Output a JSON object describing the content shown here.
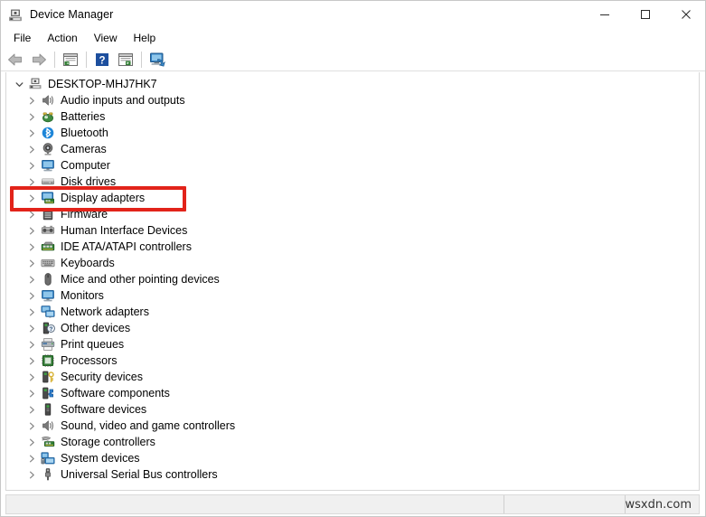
{
  "window": {
    "title": "Device Manager",
    "icon": "device-manager-icon",
    "controls": {
      "minimize": "minimize-icon",
      "maximize": "maximize-icon",
      "close": "close-icon"
    }
  },
  "menubar": {
    "items": [
      {
        "label": "File"
      },
      {
        "label": "Action"
      },
      {
        "label": "View"
      },
      {
        "label": "Help"
      }
    ]
  },
  "toolbar": {
    "buttons": [
      {
        "name": "back-arrow-icon",
        "tooltip": "Back"
      },
      {
        "name": "forward-arrow-icon",
        "tooltip": "Forward"
      },
      {
        "name": "show-hide-console-tree-icon",
        "tooltip": "Show/Hide Console Tree"
      },
      {
        "name": "help-icon",
        "tooltip": "Help"
      },
      {
        "name": "properties-icon",
        "tooltip": "Properties"
      },
      {
        "name": "scan-for-hardware-changes-icon",
        "tooltip": "Scan for hardware changes"
      }
    ]
  },
  "tree": {
    "root": {
      "label": "DESKTOP-MHJ7HK7",
      "icon": "computer-root-icon",
      "expanded": true
    },
    "items": [
      {
        "label": "Audio inputs and outputs",
        "icon": "speaker-icon"
      },
      {
        "label": "Batteries",
        "icon": "battery-icon"
      },
      {
        "label": "Bluetooth",
        "icon": "bluetooth-icon"
      },
      {
        "label": "Cameras",
        "icon": "camera-icon"
      },
      {
        "label": "Computer",
        "icon": "monitor-icon"
      },
      {
        "label": "Disk drives",
        "icon": "disk-drive-icon"
      },
      {
        "label": "Display adapters",
        "icon": "display-adapter-icon",
        "highlighted": true
      },
      {
        "label": "Firmware",
        "icon": "firmware-icon"
      },
      {
        "label": "Human Interface Devices",
        "icon": "hid-icon"
      },
      {
        "label": "IDE ATA/ATAPI controllers",
        "icon": "ide-controller-icon"
      },
      {
        "label": "Keyboards",
        "icon": "keyboard-icon"
      },
      {
        "label": "Mice and other pointing devices",
        "icon": "mouse-icon"
      },
      {
        "label": "Monitors",
        "icon": "monitor-icon"
      },
      {
        "label": "Network adapters",
        "icon": "network-adapter-icon"
      },
      {
        "label": "Other devices",
        "icon": "other-device-icon"
      },
      {
        "label": "Print queues",
        "icon": "printer-icon"
      },
      {
        "label": "Processors",
        "icon": "processor-icon"
      },
      {
        "label": "Security devices",
        "icon": "security-device-icon"
      },
      {
        "label": "Software components",
        "icon": "software-component-icon"
      },
      {
        "label": "Software devices",
        "icon": "software-device-icon"
      },
      {
        "label": "Sound, video and game controllers",
        "icon": "speaker-icon"
      },
      {
        "label": "Storage controllers",
        "icon": "storage-controller-icon"
      },
      {
        "label": "System devices",
        "icon": "system-device-icon"
      },
      {
        "label": "Universal Serial Bus controllers",
        "icon": "usb-icon"
      }
    ]
  },
  "annotation": {
    "target": "Display adapters",
    "color": "#e2231a",
    "shape": "rectangle"
  },
  "statusbar": {
    "pane1": "",
    "pane2": "",
    "watermark": "wsxdn.com"
  }
}
